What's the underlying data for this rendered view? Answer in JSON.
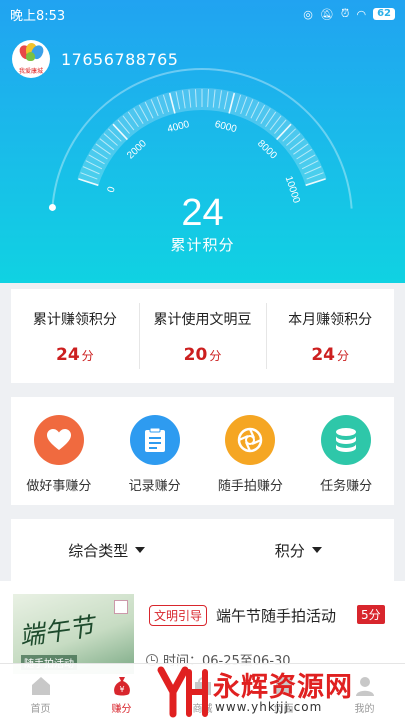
{
  "status_bar": {
    "time": "晚上8:53",
    "battery": "62"
  },
  "user": {
    "phone": "17656788765",
    "avatar_text": "我爱康城"
  },
  "gauge": {
    "max": 10000,
    "value": 24,
    "ticks": [
      "0",
      "2000",
      "4000",
      "6000",
      "8000",
      "10000"
    ]
  },
  "score": {
    "value": "24",
    "label": "累计积分"
  },
  "stats": [
    {
      "label": "累计赚领积分",
      "value": "24",
      "unit": "分"
    },
    {
      "label": "累计使用文明豆",
      "value": "20",
      "unit": "分"
    },
    {
      "label": "本月赚领积分",
      "value": "24",
      "unit": "分"
    }
  ],
  "actions": [
    {
      "label": "做好事赚分",
      "icon": "heart-icon",
      "color": "#f06a3f"
    },
    {
      "label": "记录赚分",
      "icon": "clipboard-icon",
      "color": "#2e9bf0"
    },
    {
      "label": "随手拍赚分",
      "icon": "camera-aperture-icon",
      "color": "#f5a623"
    },
    {
      "label": "任务赚分",
      "icon": "database-icon",
      "color": "#2ec7a9"
    }
  ],
  "filters": [
    {
      "label": "综合类型"
    },
    {
      "label": "积分"
    }
  ],
  "activity": {
    "tag": "文明引导",
    "title": "端午节随手拍活动",
    "points": "5分",
    "time": "时间：06-25至06-30",
    "thumb_title": "端午节",
    "thumb_sub": "随手拍活动"
  },
  "tabs": [
    {
      "label": "首页",
      "icon": "home-icon"
    },
    {
      "label": "赚分",
      "icon": "money-bag-icon"
    },
    {
      "label": "商城",
      "icon": "shop-icon"
    },
    {
      "label": "负面",
      "icon": "list-icon"
    },
    {
      "label": "我的",
      "icon": "user-icon"
    }
  ],
  "watermark": {
    "text": "永辉资源网",
    "url": "www.yhkjjj.com"
  },
  "colors": {
    "accent": "#d8262d",
    "hero_top": "#21a3f1",
    "hero_bottom": "#10d2e2"
  }
}
